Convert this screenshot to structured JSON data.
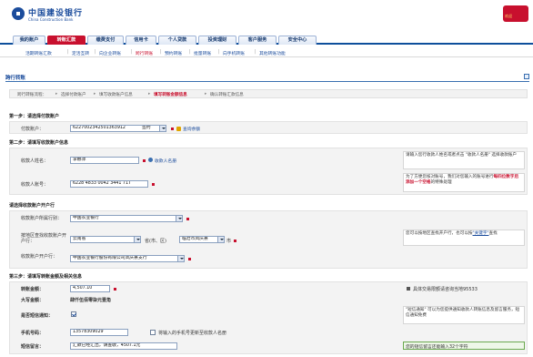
{
  "header": {
    "bank_name_cn": "中国建设银行",
    "bank_name_en": "China Construction Bank",
    "deco_text": "欢迎"
  },
  "tabs": [
    {
      "label": "我的账户"
    },
    {
      "label": "转账汇款",
      "active": true
    },
    {
      "label": "缴费支付"
    },
    {
      "label": "信用卡"
    },
    {
      "label": "个人贷款"
    },
    {
      "label": "投资理财"
    },
    {
      "label": "客户服务"
    },
    {
      "label": "安全中心"
    }
  ],
  "subnav": [
    {
      "label": "活期转账汇款"
    },
    {
      "label": "定活互转"
    },
    {
      "label": "向企业转账"
    },
    {
      "label": "跨行转账",
      "active": true
    },
    {
      "label": "预约转账"
    },
    {
      "label": "批量转账"
    },
    {
      "label": "向手机转账"
    },
    {
      "label": "其他转账功能"
    }
  ],
  "section": {
    "title": "跨行转账"
  },
  "steps": {
    "prefix": "跨行转账流程：",
    "items": [
      "选择付款账户",
      "填写收款账户信息",
      "填写转账金额信息",
      "确认转账汇款信息"
    ],
    "active_index": 2
  },
  "step1": {
    "title": "第一步：请选择付款账户",
    "account_label": "付款账户：",
    "account_value": "6227002342501363912",
    "account_type": "签约",
    "balance_link": "查询余额"
  },
  "step2": {
    "title": "第二步：请填写收款账户信息",
    "name_label": "收款人姓名：",
    "name_value": "李娜萍",
    "payee_link": "收款人名册",
    "name_hint": "请输入您行收款人姓名或者点击 \"收款人名册\" 选择收款账户",
    "acct_label": "收款人账号：",
    "acct_value": "6228 4833 0042 3441 71T",
    "acct_hint_1": "为了方便您核对账号，我们对您输入的账号进行",
    "acct_hint_red": "每四位数字后添加一个空格",
    "acct_hint_2": "的特殊处理"
  },
  "bank_section": {
    "title": "请选择收款账户开户行",
    "bank_label": "收款账户所属行别：",
    "bank_value": "中国农业银行",
    "region_label": "按地区查找收款账户开户行：",
    "province_value": "云南省",
    "province_suffix": "省(市、区)",
    "city_value": "临沧市凤庆县",
    "city_suffix": "市",
    "region_hint_1": "您可以按地区查找开户行，也可以按",
    "region_hint_link": "\"关键字\"",
    "region_hint_2": "查找",
    "branch_label": "收款账户开户行：",
    "branch_value": "中国农业银行股份有限公司凤庆县支行"
  },
  "step3": {
    "title": "第三步：请填写转账金额及相关信息",
    "amount_label": "转账金额：",
    "amount_value": "4,507.10",
    "amount_hint": "具体交易限额请咨询当地95533",
    "capital_label": "大写金额：",
    "capital_value": "肆仟伍佰零柒元壹角",
    "sms_label": "是否短信通知：",
    "sms_hint": "\"短信通知\" 可以为您提供通知收款人转账信息及留言服务，短信通知免费",
    "phone_label": "手机号码：",
    "phone_value": "13578309029",
    "phone_update_label": "将输入的手机号更新至收款人名册",
    "msg_label": "短信留言：",
    "msg_value": "汇款已经汇出，请查收，4507.1元",
    "msg_hint": "您的短信留言还能输入32个字符"
  },
  "colors": {
    "brand_blue": "#1b4c9c",
    "brand_red": "#c8102e"
  }
}
